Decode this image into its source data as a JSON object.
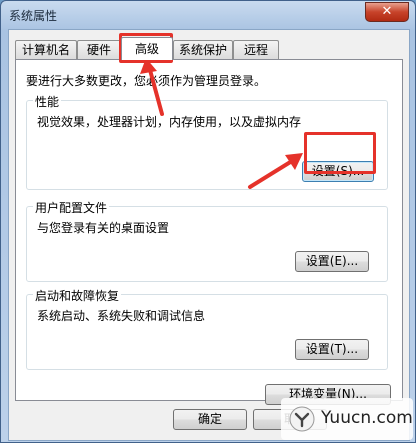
{
  "window": {
    "title": "系统属性",
    "close_glyph": "✕"
  },
  "tabs": [
    {
      "label": "计算机名"
    },
    {
      "label": "硬件"
    },
    {
      "label": "高级"
    },
    {
      "label": "系统保护"
    },
    {
      "label": "远程"
    }
  ],
  "intro_text": "要进行大多数更改，您必须作为管理员登录。",
  "groups": {
    "performance": {
      "title": "性能",
      "desc": "视觉效果，处理器计划，内存使用，以及虚拟内存",
      "button": "设置(S)..."
    },
    "profile": {
      "title": "用户配置文件",
      "desc": "与您登录有关的桌面设置",
      "button": "设置(E)..."
    },
    "startup": {
      "title": "启动和故障恢复",
      "desc": "系统启动、系统失败和调试信息",
      "button": "设置(T)..."
    }
  },
  "env_button": "环境变量(N)...",
  "footer": {
    "ok": "确定",
    "cancel": "取"
  },
  "watermark": {
    "text": "Yuucn.com"
  },
  "colors": {
    "highlight": "#e5322a",
    "close_button": "#c7432a",
    "focus_border": "#3c7fb1"
  }
}
